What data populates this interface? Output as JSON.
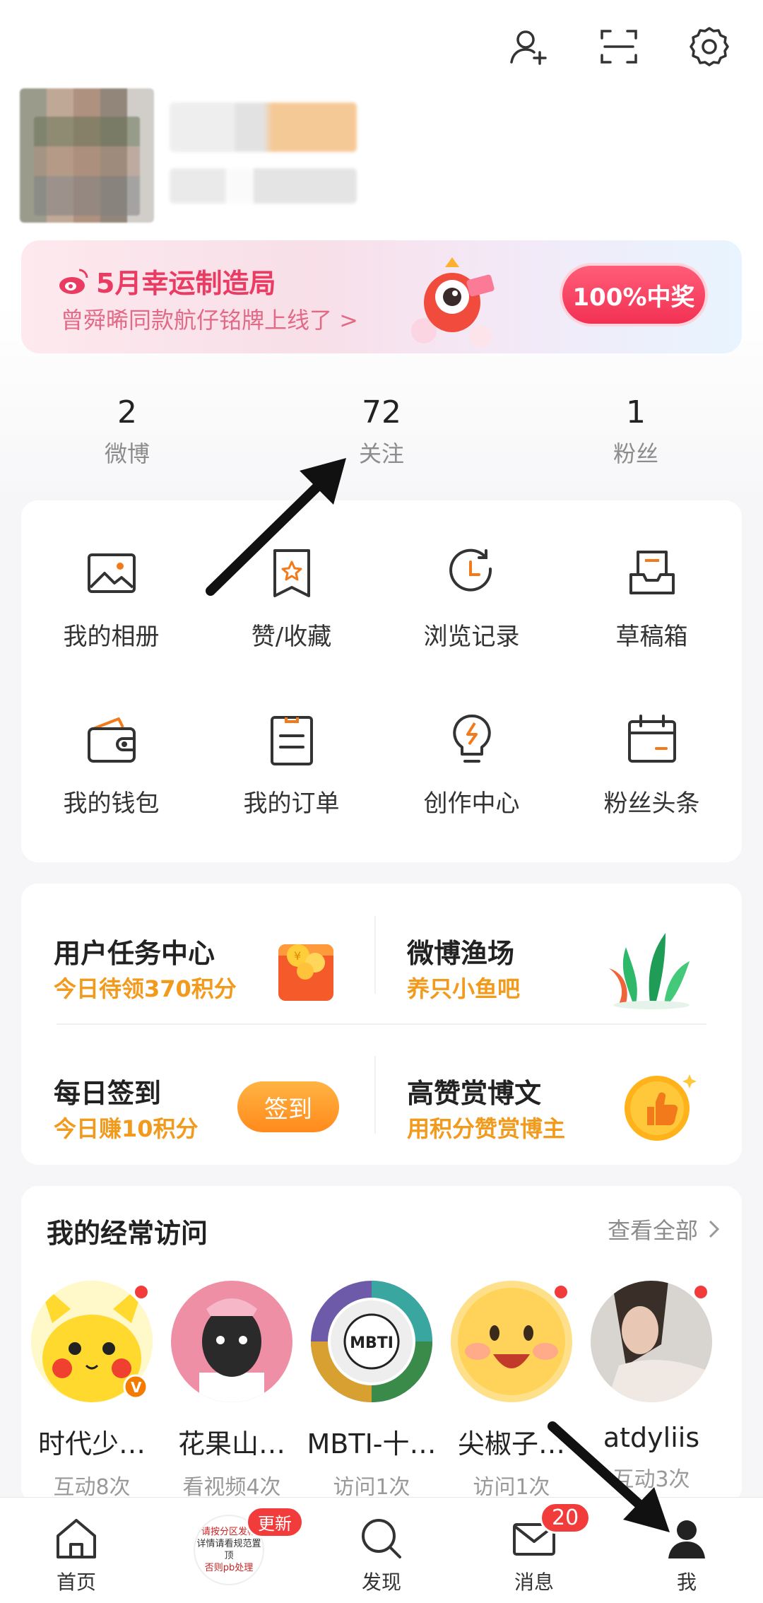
{
  "banner": {
    "title": "5月幸运制造局",
    "subtitle": "曾舜晞同款航仔铭牌上线了 >",
    "button": "100%中奖"
  },
  "stats": [
    {
      "num": "2",
      "label": "微博"
    },
    {
      "num": "72",
      "label": "关注"
    },
    {
      "num": "1",
      "label": "粉丝"
    }
  ],
  "grid": [
    {
      "label": "我的相册",
      "icon": "photo-album-icon"
    },
    {
      "label": "赞/收藏",
      "icon": "bookmark-star-icon"
    },
    {
      "label": "浏览记录",
      "icon": "history-clock-icon"
    },
    {
      "label": "草稿箱",
      "icon": "drafts-tray-icon"
    },
    {
      "label": "我的钱包",
      "icon": "wallet-icon"
    },
    {
      "label": "我的订单",
      "icon": "order-list-icon"
    },
    {
      "label": "创作中心",
      "icon": "lightbulb-icon"
    },
    {
      "label": "粉丝头条",
      "icon": "calendar-icon"
    }
  ],
  "tasks": {
    "task_center": {
      "title": "用户任务中心",
      "sub": "今日待领370积分"
    },
    "fishing": {
      "title": "微博渔场",
      "sub": "养只小鱼吧"
    },
    "checkin": {
      "title": "每日签到",
      "sub": "今日赚10积分",
      "button": "签到"
    },
    "reward": {
      "title": "高赞赏博文",
      "sub": "用积分赞赏博主"
    }
  },
  "frequent": {
    "title": "我的经常访问",
    "more": "查看全部",
    "items": [
      {
        "name": "时代少…",
        "sub": "互动8次"
      },
      {
        "name": "花果山…",
        "sub": "看视频4次"
      },
      {
        "name": "MBTI-十…",
        "sub": "访问1次"
      },
      {
        "name": "尖椒子…",
        "sub": "访问1次"
      },
      {
        "name": "atdyliis",
        "sub": "互动3次"
      }
    ],
    "mbti_text": "MBTI"
  },
  "nav": {
    "home": "首页",
    "discover": "发现",
    "messages": "消息",
    "me": "我",
    "update_badge": "更新",
    "message_count": "20",
    "promo_lines": [
      "请按分区发帖",
      "详情请看规范置顶",
      "否则pb处理"
    ]
  },
  "colors": {
    "accent_orange": "#f29a1c",
    "banner_red": "#ea3b63",
    "badge_red": "#f23c3c"
  }
}
